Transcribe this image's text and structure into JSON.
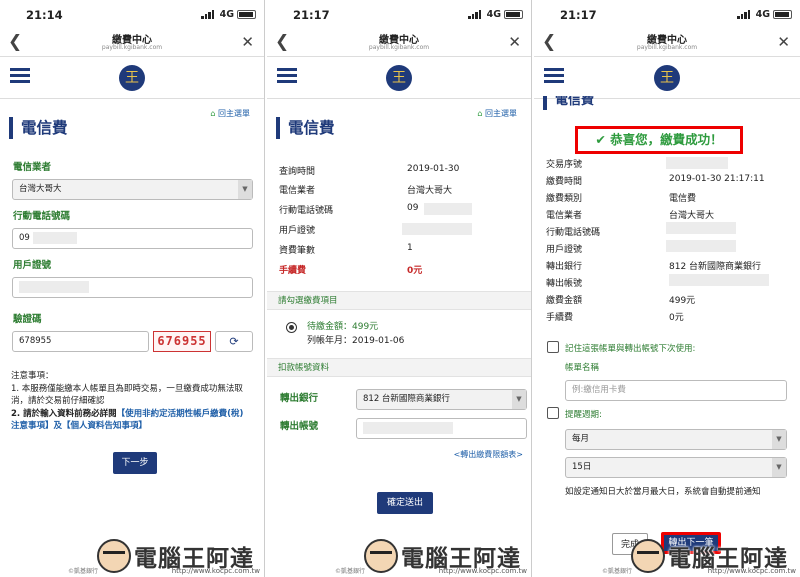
{
  "status": {
    "t1": "21:14",
    "t2": "21:17",
    "t3": "21:17",
    "net": "4G"
  },
  "nav": {
    "title": "繳費中心",
    "url": "paybill.kgibank.com"
  },
  "logo": "王",
  "home_link": "回主選單",
  "page_title": "電信費",
  "p1": {
    "carrier_label": "電信業者",
    "carrier_value": "台灣大哥大",
    "phone_label": "行動電話號碼",
    "phone_value": "09",
    "id_label": "用戶證號",
    "captcha_label": "驗證碼",
    "captcha_input": "678955",
    "captcha_image": "676955",
    "notes_title": "注意事項：",
    "note1": "1. 本服務僅能繳本人帳單且為即時交易，一旦繳費成功無法取消，請於交易前仔細確認",
    "note2_prefix": "2. 請於輸入資料前務必詳閱",
    "note2_link": "【使用非約定活期性帳戶繳費(稅)注意事項】及【個人資料告知事項】",
    "next_button": "下一步"
  },
  "p2": {
    "rows": [
      {
        "label": "查詢時間",
        "value": "2019-01-30"
      },
      {
        "label": "電信業者",
        "value": "台灣大哥大"
      },
      {
        "label": "行動電話號碼",
        "value": "09"
      },
      {
        "label": "用戶證號",
        "value": ""
      },
      {
        "label": "資費筆數",
        "value": "1"
      },
      {
        "label": "手續費",
        "value": "0元"
      }
    ],
    "select_section": "請勾選繳費項目",
    "due_amount": "待繳金額：499元",
    "due_month": "列帳年月：2019-01-06",
    "debit_section": "扣款帳號資料",
    "bank_label": "轉出銀行",
    "bank_value": "812 台新國際商業銀行",
    "account_label": "轉出帳號",
    "limit_link": "<轉出繳費限額表>",
    "confirm_button": "確定送出"
  },
  "p3": {
    "title_partial": "電信費",
    "success": "恭喜您，繳費成功！",
    "rows": [
      {
        "label": "交易序號",
        "value": ""
      },
      {
        "label": "繳費時間",
        "value": "2019-01-30 21:17:11"
      },
      {
        "label": "繳費類別",
        "value": "電信費"
      },
      {
        "label": "電信業者",
        "value": "台灣大哥大"
      },
      {
        "label": "行動電話號碼",
        "value": ""
      },
      {
        "label": "用戶證號",
        "value": ""
      },
      {
        "label": "轉出銀行",
        "value": "812 台新國際商業銀行"
      },
      {
        "label": "轉出帳號",
        "value": ""
      },
      {
        "label": "繳費金額",
        "value": "499元"
      },
      {
        "label": "手續費",
        "value": "0元"
      }
    ],
    "remember": "記住這張帳單與轉出帳號下次使用:",
    "bill_name_label": "帳單名稱",
    "bill_name_placeholder": "例:繳信用卡費",
    "reminder_label": "提醒週期:",
    "period_value": "每月",
    "day_value": "15日",
    "reminder_note": "如設定通知日大於當月最大日，系統會自動提前通知",
    "done_button": "完成",
    "second_button": "轉出下一筆"
  },
  "watermark": {
    "text": "電腦王阿達",
    "url": "http://www.kocpc.com.tw",
    "copyright": "©凱基銀行"
  }
}
